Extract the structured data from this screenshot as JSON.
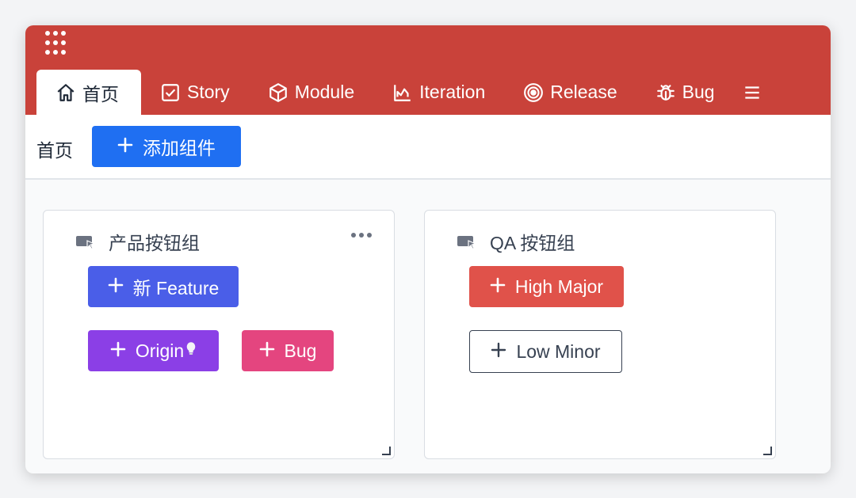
{
  "tabs": [
    {
      "label": "首页",
      "icon": "home-icon"
    },
    {
      "label": "Story",
      "icon": "checkbox-icon"
    },
    {
      "label": "Module",
      "icon": "cube-icon"
    },
    {
      "label": "Iteration",
      "icon": "chart-icon"
    },
    {
      "label": "Release",
      "icon": "target-icon"
    },
    {
      "label": "Bug",
      "icon": "bug-icon"
    }
  ],
  "toolbar": {
    "page_label": "首页",
    "add_label": "添加组件"
  },
  "cards": [
    {
      "title": "产品按钮组",
      "buttons": [
        {
          "label": "新 Feature",
          "color": "#4a5ee8"
        },
        {
          "label": "Origin",
          "color": "#8b3fe6"
        },
        {
          "label": "Bug",
          "color": "#e4457f"
        }
      ]
    },
    {
      "title": "QA 按钮组",
      "buttons": [
        {
          "label": "High Major",
          "color": "#e0524a"
        },
        {
          "label": "Low Minor",
          "color": "#ffffff"
        }
      ]
    }
  ],
  "colors": {
    "header": "#c9423a",
    "primary": "#1f6ff2"
  }
}
